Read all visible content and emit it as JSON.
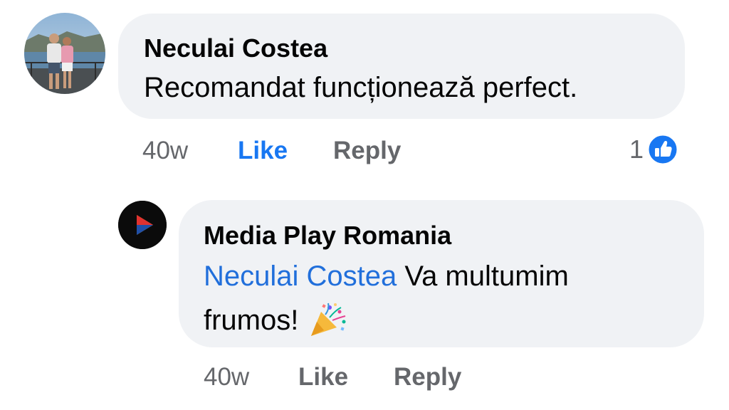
{
  "comment": {
    "author": "Neculai Costea",
    "text": "Recomandat funcționează perfect.",
    "time": "40w",
    "like_label": "Like",
    "reply_label": "Reply",
    "reaction_count": "1",
    "reaction_icon": "like-thumb-icon",
    "accent_color": "#1877f2"
  },
  "reply": {
    "author": "Media Play Romania",
    "mention": "Neculai Costea",
    "text_line1": " Va multumim",
    "text_line2": "frumos!",
    "emoji": "party-popper-icon",
    "time": "40w",
    "like_label": "Like",
    "reply_label": "Reply"
  }
}
